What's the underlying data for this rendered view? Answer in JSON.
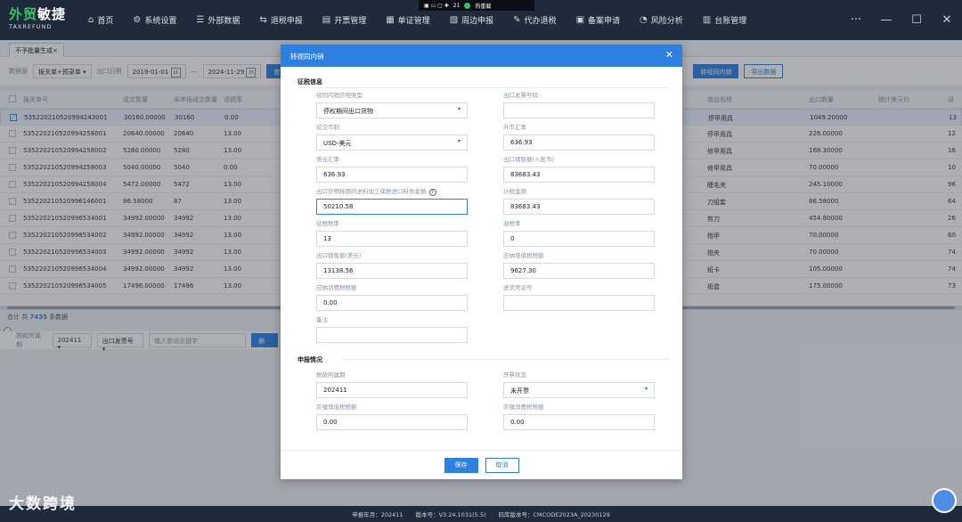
{
  "brand": {
    "name_a": "外贸",
    "name_b": "敏捷",
    "sub": "TAXREFUND"
  },
  "nav": [
    {
      "icon": "⌂",
      "label": "首页"
    },
    {
      "icon": "⚙",
      "label": "系统设置"
    },
    {
      "icon": "☰",
      "label": "外部数据"
    },
    {
      "icon": "⇆",
      "label": "退税申报"
    },
    {
      "icon": "▤",
      "label": "开票管理"
    },
    {
      "icon": "▦",
      "label": "单证管理"
    },
    {
      "icon": "▧",
      "label": "周边申报"
    },
    {
      "icon": "✎",
      "label": "代办退税"
    },
    {
      "icon": "▣",
      "label": "备案申请"
    },
    {
      "icon": "◔",
      "label": "风险分析"
    },
    {
      "icon": "▥",
      "label": "台账管理"
    }
  ],
  "window": {
    "more": "···",
    "minimize": "—",
    "maximize": "☐",
    "close": "✕"
  },
  "hotstrip": {
    "count": "21",
    "status": "热重载"
  },
  "tab": {
    "label": "不予批量生成",
    "close": "×"
  },
  "filters": {
    "source_label": "数据源",
    "source_value": "报关单+预录单",
    "date_label": "出口日期",
    "date_from": "2019-01-01",
    "date_to": "2024-11-29",
    "query": "查询",
    "to_domestic": "转视同内销",
    "export": "导出数据"
  },
  "table": {
    "headers": [
      "报关单号",
      "成交数量",
      "未申报成交数量",
      "退税率",
      "",
      "商品名称",
      "出口数量",
      "统计美元价",
      "成"
    ],
    "rows": [
      {
        "id": "53522021052099424300​1",
        "qty": "30160.00000",
        "undeclared": "30160",
        "rate": "0.00",
        "name": "停甲用具",
        "export_qty": "1049.20000",
        "last": "13",
        "selected": true
      },
      {
        "id": "535220210520994258001",
        "qty": "20640.00000",
        "undeclared": "20640",
        "rate": "13.00",
        "name": "停甲用具",
        "export_qty": "226.00000",
        "last": "12",
        "selected": false
      },
      {
        "id": "535220210520994258002",
        "qty": "5280.00000",
        "undeclared": "5280",
        "rate": "13.00",
        "name": "修甲用具",
        "export_qty": "168.30000",
        "last": "16",
        "selected": false
      },
      {
        "id": "535220210520994258003",
        "qty": "5040.00000",
        "undeclared": "5040",
        "rate": "0.00",
        "name": "修甲用具",
        "export_qty": "70.00000",
        "last": "10",
        "selected": false
      },
      {
        "id": "535220210520994258004",
        "qty": "5472.00000",
        "undeclared": "5472",
        "rate": "13.00",
        "name": "睫毛夹",
        "export_qty": "245.10000",
        "last": "96",
        "selected": false
      },
      {
        "id": "535220210520996146001",
        "qty": "86.58000",
        "undeclared": "87",
        "rate": "13.00",
        "name": "刀组套",
        "export_qty": "86.58000",
        "last": "64",
        "selected": false
      },
      {
        "id": "535220210520996534001",
        "qty": "34992.00000",
        "undeclared": "34992",
        "rate": "13.00",
        "name": "剪刀",
        "export_qty": "454.80000",
        "last": "26",
        "selected": false
      },
      {
        "id": "535220210520996534002",
        "qty": "34992.00000",
        "undeclared": "34992",
        "rate": "13.00",
        "name": "指甲",
        "export_qty": "70.00000",
        "last": "60",
        "selected": false
      },
      {
        "id": "535220210520996534003",
        "qty": "34992.00000",
        "undeclared": "34992",
        "rate": "13.00",
        "name": "指夹",
        "export_qty": "70.00000",
        "last": "74",
        "selected": false
      },
      {
        "id": "535220210520996534004",
        "qty": "34992.00000",
        "undeclared": "34992",
        "rate": "13.00",
        "name": "纸卡",
        "export_qty": "105.00000",
        "last": "74",
        "selected": false
      },
      {
        "id": "535220210520996534005",
        "qty": "17496.00000",
        "undeclared": "17496",
        "rate": "13.00",
        "name": "纸盒",
        "export_qty": "175.00000",
        "last": "73",
        "selected": false
      }
    ]
  },
  "footer": {
    "total_prefix": "合计",
    "total_word": "共",
    "total_count": "7435",
    "total_suffix": "条数据"
  },
  "bottom_filter": {
    "period_label": "税款所属期",
    "period_value": "202411",
    "type_value": "出口发票号",
    "keyword_placeholder": "输入查询关键字",
    "delete": "删除"
  },
  "modal": {
    "title": "转视同内销",
    "close": "✕",
    "section1": "征税信息",
    "fields": {
      "goods_type_label": "视同内销货物类型",
      "goods_type_value": "停权期间出口货物",
      "invoice_label": "出口发票号码",
      "invoice_value": "",
      "currency_label": "成交币制",
      "currency_value": "USD-美元",
      "fx_label": "外币汇率",
      "fx_value": "636.93",
      "usd_rate_label": "美元汇率",
      "usd_rate_value": "636.93",
      "sales_rmb_label": "出口销售额(人民币)",
      "sales_rmb_value": "83683.43",
      "processing_label": "出口货物耗用的进料加工保税进口料件金额",
      "processing_value": "50210.58",
      "taxbase_label": "计税金额",
      "taxbase_value": "83683.43",
      "levy_rate_label": "征税税率",
      "levy_rate_value": "13",
      "refund_rate_label": "退税率",
      "refund_rate_value": "0",
      "sales_usd_label": "出口销售额(美元)",
      "sales_usd_value": "13138.56",
      "vat_due_label": "应纳增值税税额",
      "vat_due_value": "9627.30",
      "consumption_due_label": "应纳消费税税额",
      "consumption_due_value": "0.00",
      "inbound_voucher_label": "进货凭证号",
      "inbound_voucher_value": "",
      "note_label": "备注",
      "note_value": ""
    },
    "section2": "申报情况",
    "fields2": {
      "period_label": "税款所属期",
      "period_value": "202411",
      "invoice_status_label": "开票状态",
      "invoice_status_value": "未开票",
      "actual_vat_label": "实缴增值税税额",
      "actual_vat_value": "0.00",
      "actual_consumption_label": "实缴消费税税额",
      "actual_consumption_value": "0.00"
    },
    "save": "保存",
    "cancel": "取消"
  },
  "status": {
    "period": "申报年月：202411",
    "version": "版本号：V3.24.1031(5.5)",
    "code": "码库版本号：CMCODE2023A_20230129"
  },
  "watermark": "大数跨境"
}
